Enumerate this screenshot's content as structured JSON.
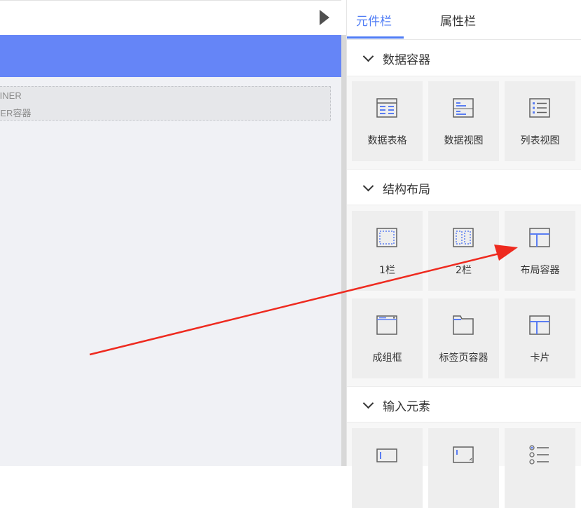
{
  "canvas": {
    "container_line1": "AINER",
    "container_line2": "NER容器"
  },
  "panel": {
    "tabs": [
      {
        "label": "元件栏",
        "active": true
      },
      {
        "label": "属性栏",
        "active": false
      }
    ],
    "sections": [
      {
        "title": "数据容器",
        "items": [
          {
            "label": "数据表格",
            "icon": "data-table-icon"
          },
          {
            "label": "数据视图",
            "icon": "data-view-icon"
          },
          {
            "label": "列表视图",
            "icon": "list-view-icon"
          }
        ]
      },
      {
        "title": "结构布局",
        "items": [
          {
            "label": "1栏",
            "icon": "one-column-icon"
          },
          {
            "label": "2栏",
            "icon": "two-column-icon"
          },
          {
            "label": "布局容器",
            "icon": "layout-container-icon"
          },
          {
            "label": "成组框",
            "icon": "group-box-icon"
          },
          {
            "label": "标签页容器",
            "icon": "tab-container-icon"
          },
          {
            "label": "卡片",
            "icon": "card-icon"
          }
        ]
      },
      {
        "title": "输入元素",
        "items": [
          {
            "icon": "text-input-icon"
          },
          {
            "icon": "textarea-icon"
          },
          {
            "icon": "radio-list-icon"
          }
        ]
      }
    ]
  },
  "colors": {
    "accent": "#4f7cf5",
    "header_band": "#6585f7",
    "canvas_bg": "#f0f1f5",
    "tile_bg": "#eeeeee",
    "annotation_arrow": "#ee2a1f"
  }
}
